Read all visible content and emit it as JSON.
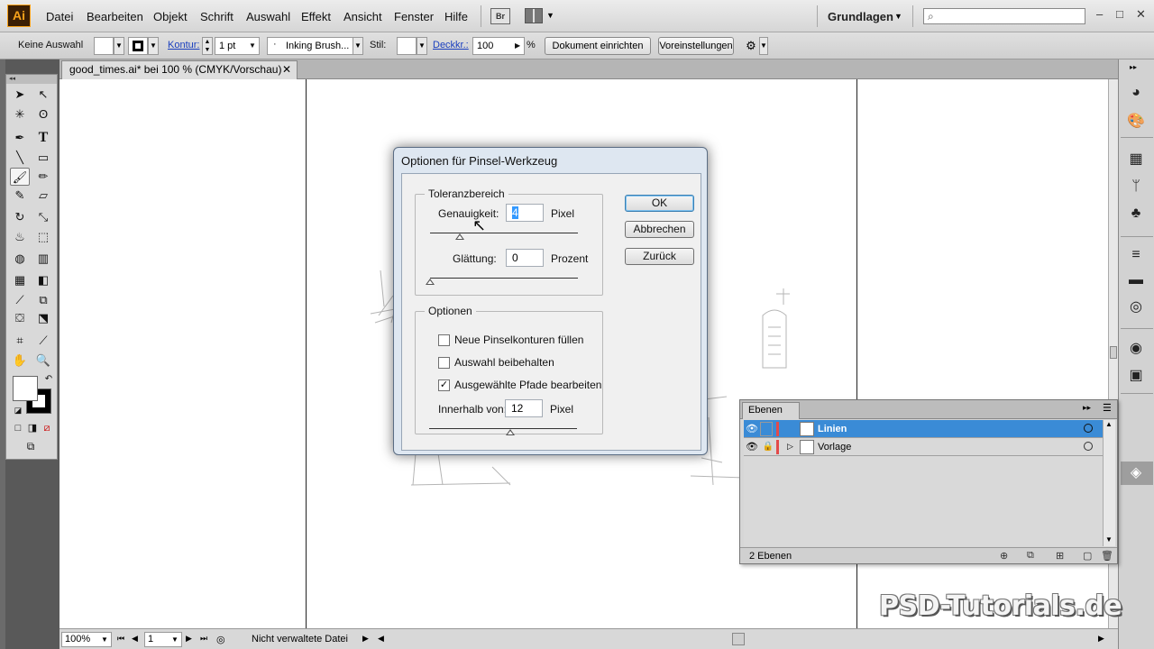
{
  "menubar": {
    "logo": "Ai",
    "items": [
      "Datei",
      "Bearbeiten",
      "Objekt",
      "Schrift",
      "Auswahl",
      "Effekt",
      "Ansicht",
      "Fenster",
      "Hilfe"
    ],
    "bridge_label": "Br",
    "workspace": "Grundlagen",
    "search_placeholder": ""
  },
  "controlbar": {
    "selection": "Keine Auswahl",
    "stroke_label": "Kontur:",
    "stroke_weight": "1 pt",
    "brush": "Inking Brush...",
    "style_label": "Stil:",
    "opacity_label": "Deckkr.:",
    "opacity_value": "100",
    "percent": "%",
    "doc_setup": "Dokument einrichten",
    "preferences": "Voreinstellungen"
  },
  "document": {
    "tab_title": "good_times.ai* bei 100 % (CMYK/Vorschau)",
    "zoom": "100%",
    "artboard": "1",
    "status": "Nicht verwaltete Datei"
  },
  "dialog": {
    "title": "Optionen für Pinsel-Werkzeug",
    "tolerance_group": "Toleranzbereich",
    "fidelity_label": "Genauigkeit:",
    "fidelity_value": "4",
    "fidelity_unit": "Pixel",
    "smoothness_label": "Glättung:",
    "smoothness_value": "0",
    "smoothness_unit": "Prozent",
    "options_group": "Optionen",
    "options": [
      {
        "label": "Neue Pinselkonturen füllen",
        "checked": false
      },
      {
        "label": "Auswahl beibehalten",
        "checked": false
      },
      {
        "label": "Ausgewählte Pfade bearbeiten",
        "checked": true
      }
    ],
    "within_label": "Innerhalb von:",
    "within_value": "12",
    "within_unit": "Pixel",
    "ok": "OK",
    "cancel": "Abbrechen",
    "reset": "Zurück",
    "fidelity_slider_fraction": 0.2,
    "smoothness_slider_fraction": 0.0,
    "within_slider_fraction": 0.55
  },
  "layers": {
    "tab": "Ebenen",
    "rows": [
      {
        "name": "Linien",
        "selected": true,
        "locked": false
      },
      {
        "name": "Vorlage",
        "selected": false,
        "locked": true
      }
    ],
    "count": "2 Ebenen"
  },
  "watermark": "PSD-Tutorials.de",
  "colors": {
    "layer_selected": "#3a8bd6",
    "layer_color": "#e34a4a",
    "link": "#1a3fbf"
  }
}
